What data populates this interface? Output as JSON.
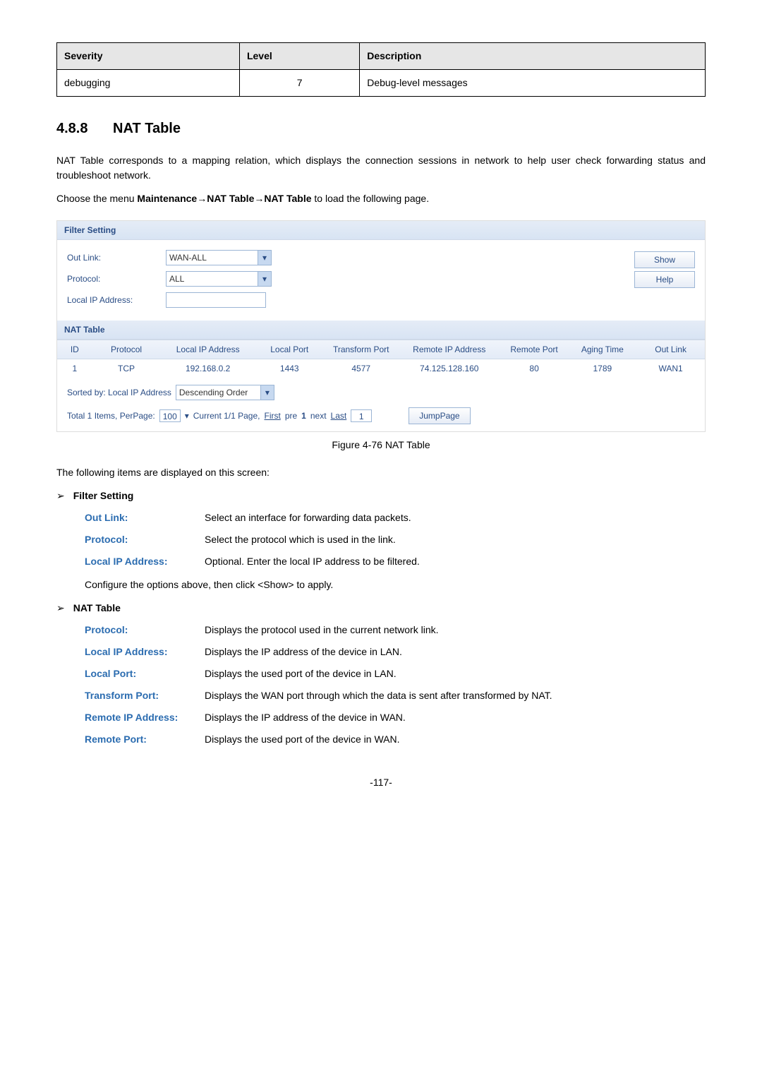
{
  "severityTable": {
    "headers": [
      "Severity",
      "Level",
      "Description"
    ],
    "row": {
      "severity": "debugging",
      "level": "7",
      "description": "Debug-level messages"
    }
  },
  "heading": {
    "num": "4.8.8",
    "title": "NAT Table"
  },
  "para1": "NAT Table corresponds to a mapping relation, which displays the connection sessions in network to help user check forwarding status and troubleshoot network.",
  "para2_pre": "Choose the menu ",
  "para2_bold": "Maintenance→NAT Table→NAT Table",
  "para2_post": " to load the following page.",
  "screenshot": {
    "filterSettingTitle": "Filter Setting",
    "outLinkLabel": "Out Link:",
    "outLinkValue": "WAN-ALL",
    "protocolLabel": "Protocol:",
    "protocolValue": "ALL",
    "localIpLabel": "Local IP Address:",
    "showBtn": "Show",
    "helpBtn": "Help",
    "natTableTitle": "NAT Table",
    "headers": {
      "id": "ID",
      "protocol": "Protocol",
      "lip": "Local IP Address",
      "lport": "Local Port",
      "tport": "Transform Port",
      "rip": "Remote IP Address",
      "rport": "Remote Port",
      "aging": "Aging Time",
      "out": "Out Link"
    },
    "rowData": {
      "id": "1",
      "protocol": "TCP",
      "lip": "192.168.0.2",
      "lport": "1443",
      "tport": "4577",
      "rip": "74.125.128.160",
      "rport": "80",
      "aging": "1789",
      "out": "WAN1"
    },
    "sortedBy": "Sorted by: Local IP Address",
    "sortOrder": "Descending Order",
    "pager_pre": "Total 1 Items, PerPage:",
    "pager_val": "100",
    "pager_mid1": "Current 1/1 Page,",
    "pager_first": "First",
    "pager_pre2": "pre",
    "pager_1": "1",
    "pager_next": "next",
    "pager_last": "Last",
    "pager_pageval": "1",
    "jumpBtn": "JumpPage"
  },
  "caption": "Figure 4-76 NAT Table",
  "displayedOn": "The following items are displayed on this screen:",
  "bullets": {
    "filter": "Filter Setting",
    "nat": "NAT Table"
  },
  "filterDefs": {
    "outLink": {
      "term": "Out Link:",
      "desc": "Select an interface for forwarding data packets."
    },
    "protocol": {
      "term": "Protocol:",
      "desc": "Select the protocol which is used in the link."
    },
    "localIp": {
      "term": "Local IP Address:",
      "desc": "Optional. Enter the local IP address to be filtered."
    },
    "note": "Configure the options above, then click <Show> to apply."
  },
  "natDefs": {
    "protocol": {
      "term": "Protocol:",
      "desc": "Displays the protocol used in the current network link."
    },
    "lip": {
      "term": "Local IP Address:",
      "desc": "Displays the IP address of the device in LAN."
    },
    "lport": {
      "term": "Local Port:",
      "desc": "Displays the used port of the device in LAN."
    },
    "tport": {
      "term": "Transform Port:",
      "desc": "Displays the WAN port through which the data is sent after transformed by NAT."
    },
    "rip": {
      "term": "Remote IP Address:",
      "desc": "Displays the IP address of the device in WAN."
    },
    "rport": {
      "term": "Remote Port:",
      "desc": "Displays the used port of the device in WAN."
    }
  },
  "footer": "-117-"
}
